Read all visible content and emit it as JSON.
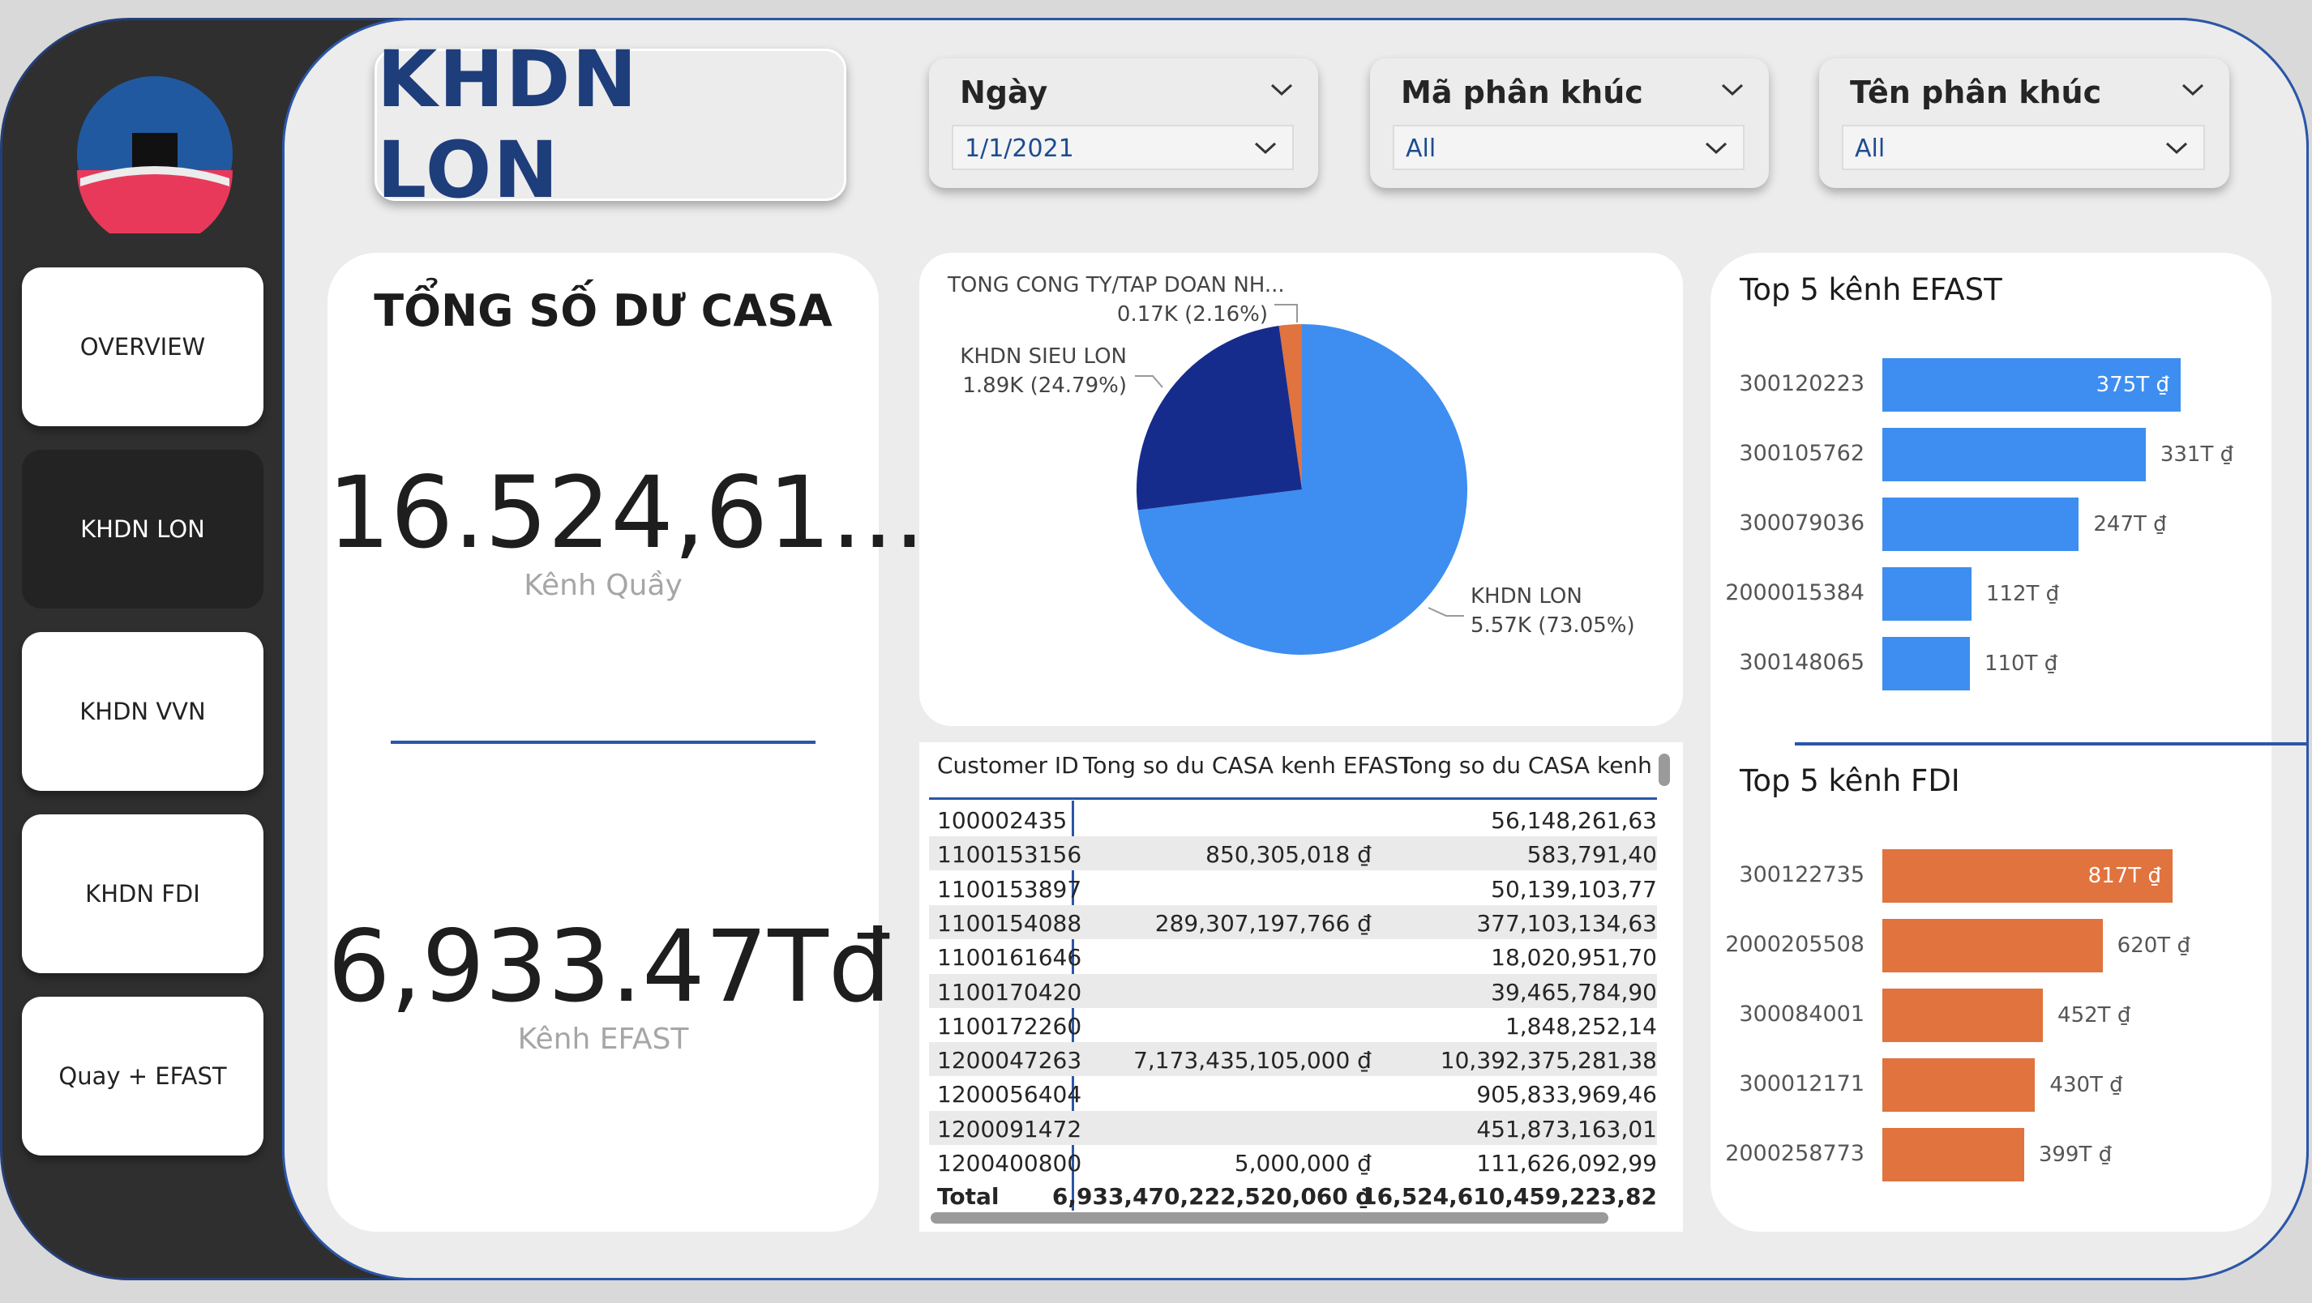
{
  "title": "KHDN LON",
  "nav": {
    "items": [
      {
        "label": "OVERVIEW"
      },
      {
        "label": "KHDN LON"
      },
      {
        "label": "KHDN VVN"
      },
      {
        "label": "KHDN FDI"
      },
      {
        "label": "Quay + EFAST"
      }
    ],
    "active": "KHDN LON"
  },
  "filters": [
    {
      "label": "Ngày",
      "value": "1/1/2021"
    },
    {
      "label": "Mã phân khúc",
      "value": "All"
    },
    {
      "label": "Tên phân khúc",
      "value": "All"
    }
  ],
  "casa": {
    "title": "TỔNG SỐ DƯ CASA",
    "quay_value": "16.524,61...",
    "quay_label": "Kênh Quầy",
    "efast_value": "6,933.47Tđ",
    "efast_label": "Kênh EFAST"
  },
  "chart_data": [
    {
      "type": "pie",
      "slices": [
        {
          "label": "KHDN LON",
          "value": 5.57,
          "display": "5.57K (73.05%)",
          "percent": 73.05,
          "color": "#3d8ef0"
        },
        {
          "label": "KHDN SIEU LON",
          "value": 1.89,
          "display": "1.89K (24.79%)",
          "percent": 24.79,
          "color": "#162c8c"
        },
        {
          "label": "TONG CONG TY/TAP DOAN NH...",
          "value": 0.17,
          "display": "0.17K (2.16%)",
          "percent": 2.16,
          "color": "#e0733e"
        }
      ]
    },
    {
      "type": "bar",
      "orientation": "horizontal",
      "title": "Top 5 kênh EFAST",
      "categories": [
        "300120223",
        "300105762",
        "300079036",
        "2000015384",
        "300148065"
      ],
      "values": [
        375,
        331,
        247,
        112,
        110
      ],
      "labels": [
        "375T ₫",
        "331T ₫",
        "247T ₫",
        "112T ₫",
        "110T ₫"
      ],
      "color": "#3d8ef0"
    },
    {
      "type": "bar",
      "orientation": "horizontal",
      "title": "Top 5 kênh FDI",
      "categories": [
        "300122735",
        "2000205508",
        "300084001",
        "300012171",
        "2000258773"
      ],
      "values": [
        817,
        620,
        452,
        430,
        399
      ],
      "labels": [
        "817T ₫",
        "620T ₫",
        "452T ₫",
        "430T ₫",
        "399T ₫"
      ],
      "color": "#e0733e"
    }
  ],
  "table": {
    "headers": [
      "Customer ID",
      "Tong so du CASA kenh EFAST",
      "Tong so du CASA kenh Qu"
    ],
    "rows": [
      [
        "100002435",
        "",
        "56,148,261,63"
      ],
      [
        "1100153156",
        "850,305,018 ₫",
        "583,791,40"
      ],
      [
        "1100153897",
        "",
        "50,139,103,77"
      ],
      [
        "1100154088",
        "289,307,197,766 ₫",
        "377,103,134,63"
      ],
      [
        "1100161646",
        "",
        "18,020,951,70"
      ],
      [
        "1100170420",
        "",
        "39,465,784,90"
      ],
      [
        "1100172260",
        "",
        "1,848,252,14"
      ],
      [
        "1200047263",
        "7,173,435,105,000 ₫",
        "10,392,375,281,38"
      ],
      [
        "1200056404",
        "",
        "905,833,969,46"
      ],
      [
        "1200091472",
        "",
        "451,873,163,01"
      ],
      [
        "1200400800",
        "5,000,000 ₫",
        "111,626,092,99"
      ]
    ],
    "total": [
      "Total",
      "6,933,470,222,520,060 ₫",
      "16,524,610,459,223,82"
    ]
  }
}
